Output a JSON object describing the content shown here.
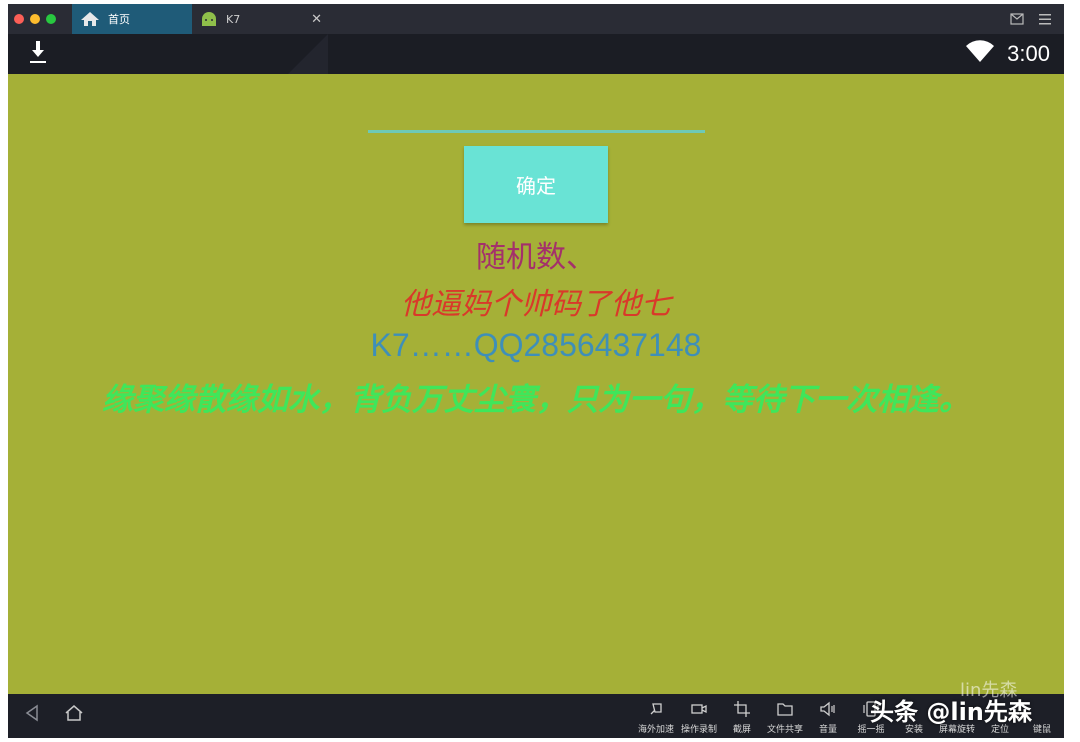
{
  "tabs": [
    {
      "label": "首页",
      "icon": "home-icon"
    },
    {
      "label": "K7",
      "icon": "android-icon"
    }
  ],
  "status": {
    "time": "3:00"
  },
  "form": {
    "button_label": "确定"
  },
  "lines": {
    "l1": "随机数、",
    "l2": "他逼妈个帅码了他七",
    "l3": "K7……QQ2856437148",
    "l4": "缘聚缘散缘如水，背负万丈尘寰，只为一句，等待下一次相逢。"
  },
  "toolbar": [
    {
      "label": "海外加速",
      "icon": "rocket-icon"
    },
    {
      "label": "操作录制",
      "icon": "video-icon"
    },
    {
      "label": "截屏",
      "icon": "crop-icon"
    },
    {
      "label": "文件共享",
      "icon": "folder-icon"
    },
    {
      "label": "音量",
      "icon": "volume-icon"
    },
    {
      "label": "摇一摇",
      "icon": "shake-icon"
    },
    {
      "label": "安装",
      "icon": "install-icon"
    },
    {
      "label": "屏幕旋转",
      "icon": "rotate-icon"
    },
    {
      "label": "定位",
      "icon": "location-icon"
    },
    {
      "label": "键鼠",
      "icon": "keyboard-icon"
    }
  ],
  "watermark": {
    "text": "头条 @lin先森",
    "faint": "lin先森"
  },
  "colors": {
    "background": "#a5b037",
    "button": "#69e3d5",
    "line1": "#a4306b",
    "line2": "#d9392a",
    "line3": "#3f8fb8",
    "line4": "#3fe65a"
  }
}
